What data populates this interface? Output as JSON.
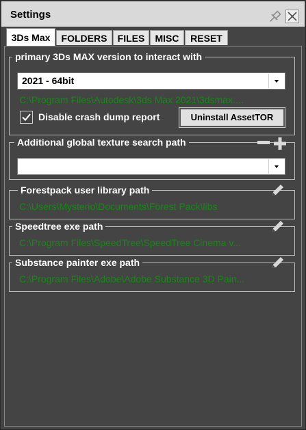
{
  "window": {
    "title": "Settings"
  },
  "tabs": [
    {
      "label": "3Ds Max",
      "active": true
    },
    {
      "label": "FOLDERS",
      "active": false
    },
    {
      "label": "FILES",
      "active": false
    },
    {
      "label": "MISC",
      "active": false
    },
    {
      "label": "RESET",
      "active": false
    }
  ],
  "max_version": {
    "legend": "primary 3Ds MAX version to interact with",
    "selected": "2021 - 64bit",
    "path": "C:\\Program Files\\Autodesk\\3ds Max 2021\\3dsmax.exe",
    "path_display": "C:\\Program Files\\Autodesk\\3ds Max 2021\\3dsmax....",
    "disable_crash_dump_label": "Disable crash dump report",
    "disable_crash_dump_checked": true,
    "uninstall_label": "Uninstall AssetTOR"
  },
  "texture_search": {
    "legend": "Additional global  texture search path",
    "selected": ""
  },
  "forestpack": {
    "legend": "Forestpack user library path",
    "path_display": "C:\\Users\\Mysterio\\Documents\\Forest Pack\\libs"
  },
  "speedtree": {
    "legend": "Speedtree exe path",
    "path_display": "C:\\Program Files\\SpeedTree\\SpeedTree Cinema v..."
  },
  "substance": {
    "legend": "Substance painter exe path",
    "path_display": "C:\\Program Files\\Adobe\\Adobe Substance 3D Pain..."
  },
  "colors": {
    "window_bg": "#444444",
    "path_text": "#138a13",
    "text": "#ffffff"
  },
  "icons": [
    "pin-icon",
    "close-icon",
    "chevron-down-icon",
    "minus-icon",
    "plus-icon",
    "pencil-icon",
    "checkmark-icon"
  ]
}
